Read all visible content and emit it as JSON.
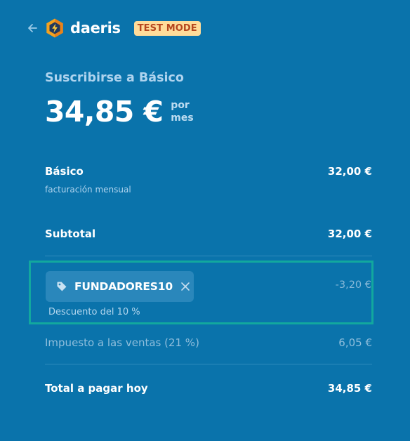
{
  "header": {
    "back_icon": "arrow-left-icon",
    "logo_icon": "daeris-lightning-logo",
    "brand": "daeris",
    "badge": "TEST MODE"
  },
  "summary": {
    "plan_title": "Suscribirse a Básico",
    "price": "34,85 €",
    "period_line1": "por",
    "period_line2": "mes"
  },
  "items": [
    {
      "name": "Básico",
      "description": "facturación mensual",
      "amount": "32,00 €"
    }
  ],
  "subtotal": {
    "label": "Subtotal",
    "amount": "32,00 €"
  },
  "promo": {
    "icon": "tag-icon",
    "code": "FUNDADORES10",
    "remove_icon": "close-icon",
    "description": "Descuento del 10 %",
    "amount": "-3,20 €"
  },
  "tax": {
    "label": "Impuesto a las ventas (21 %)",
    "amount": "6,05 €"
  },
  "total": {
    "label": "Total a pagar hoy",
    "amount": "34,85 €"
  },
  "colors": {
    "background": "#0a73ab",
    "badge_background": "#ffdc9a",
    "badge_text": "#b6461e",
    "highlight_border": "#12a89e"
  }
}
